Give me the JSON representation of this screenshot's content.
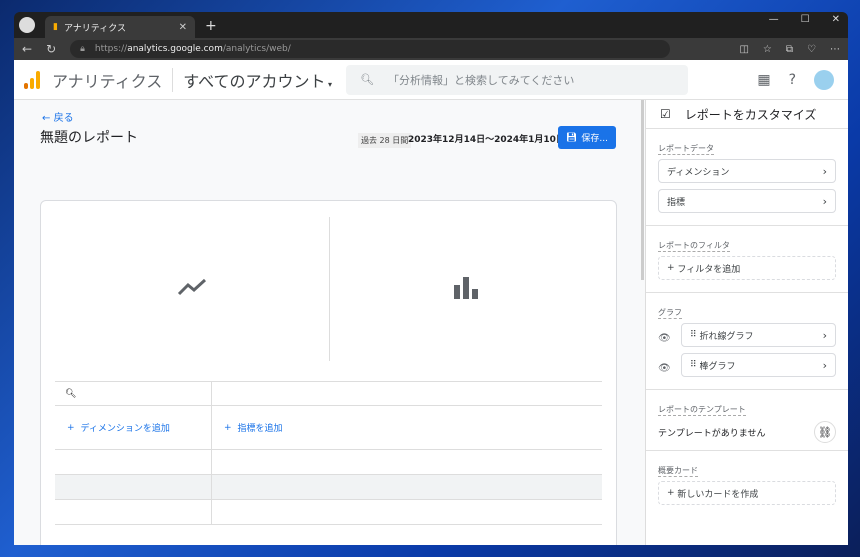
{
  "browser": {
    "tab_title": "アナリティクス",
    "url_prefix": "https://",
    "url_host": "analytics.google.com",
    "url_path": "/analytics/web/"
  },
  "header": {
    "app_name": "アナリティクス",
    "account": "すべてのアカウント",
    "search_placeholder": "「分析情報」と検索してみてください"
  },
  "report": {
    "back": "戻る",
    "title": "無題のレポート",
    "period": "過去 28 日間",
    "dates": "2023年12月14日～2024年1月10日",
    "save": "保存..."
  },
  "table": {
    "add_dimension": "ディメンションを追加",
    "add_metric": "指標を追加"
  },
  "sidebar": {
    "title": "レポートをカスタマイズ",
    "report_data_label": "レポートデータ",
    "dimension": "ディメンション",
    "metric": "指標",
    "filter_label": "レポートのフィルタ",
    "add_filter": "フィルタを追加",
    "graph_label": "グラフ",
    "line_graph": "折れ線グラフ",
    "bar_graph": "棒グラフ",
    "template_label": "レポートのテンプレート",
    "no_template": "テンプレートがありません",
    "summary_label": "概要カード",
    "new_card": "新しいカードを作成"
  },
  "colors": {
    "accent": "#1a73e8",
    "logo": "#f9ab00"
  }
}
